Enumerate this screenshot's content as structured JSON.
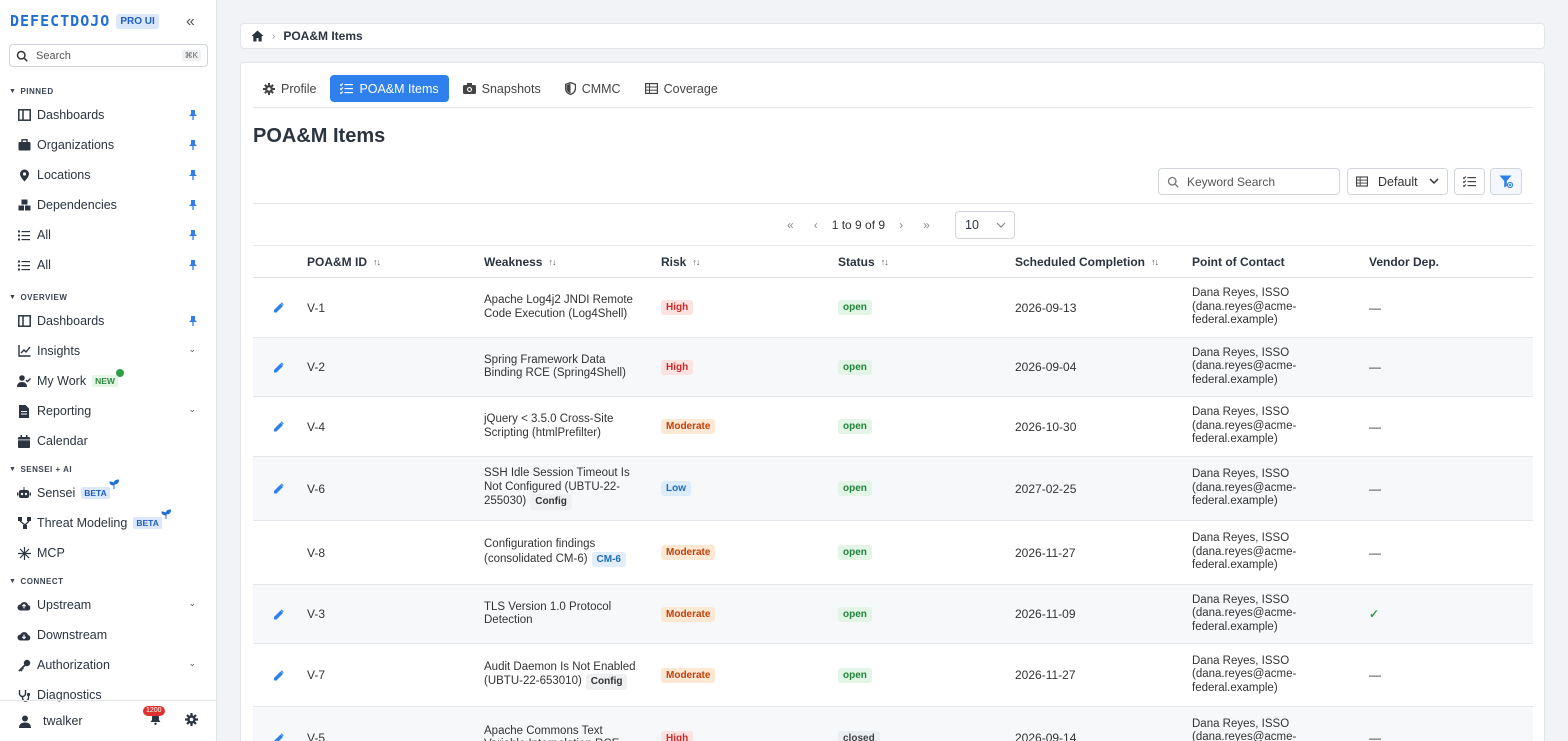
{
  "sidebar": {
    "logo": "DEFECTDOJO",
    "pro_badge": "PRO UI",
    "search_placeholder": "Search",
    "search_shortcut": "⌘K",
    "sections": {
      "pinned": "PINNED",
      "overview": "OVERVIEW",
      "sensei": "SENSEI + AI",
      "connect": "CONNECT"
    },
    "pinned_items": [
      "Dashboards",
      "Organizations",
      "Locations",
      "Dependencies",
      "All",
      "All"
    ],
    "overview_items": [
      "Dashboards",
      "Insights",
      "My Work",
      "Reporting",
      "Calendar"
    ],
    "new_badge": "NEW",
    "sensei_items": [
      "Sensei",
      "Threat Modeling",
      "MCP"
    ],
    "beta_badge": "BETA",
    "connect_items": [
      "Upstream",
      "Downstream",
      "Authorization",
      "Diagnostics"
    ],
    "user": "twalker",
    "notification_count": "1200"
  },
  "breadcrumb": {
    "current": "POA&M Items"
  },
  "tabs": [
    "Profile",
    "POA&M Items",
    "Snapshots",
    "CMMC",
    "Coverage"
  ],
  "active_tab": 1,
  "page_title": "POA&M Items",
  "toolbar": {
    "keyword_placeholder": "Keyword Search",
    "view_value": "Default"
  },
  "pagination": {
    "range": "1 to 9 of 9",
    "per_page": "10"
  },
  "table": {
    "columns": [
      "POA&M ID",
      "Weakness",
      "Risk",
      "Status",
      "Scheduled Completion",
      "Point of Contact",
      "Vendor Dep."
    ],
    "rows": [
      {
        "id": "V-1",
        "weakness": "Apache Log4j2 JNDI Remote Code Execution (Log4Shell)",
        "tag": "",
        "risk": "High",
        "status": "open",
        "date": "2026-09-13",
        "poc": "Dana Reyes, ISSO (dana.reyes@acme-federal.example)",
        "vendor": "—",
        "editable": true
      },
      {
        "id": "V-2",
        "weakness": "Spring Framework Data Binding RCE (Spring4Shell)",
        "tag": "",
        "risk": "High",
        "status": "open",
        "date": "2026-09-04",
        "poc": "Dana Reyes, ISSO (dana.reyes@acme-federal.example)",
        "vendor": "—",
        "editable": true
      },
      {
        "id": "V-4",
        "weakness": "jQuery < 3.5.0 Cross-Site Scripting (htmlPrefilter)",
        "tag": "",
        "risk": "Moderate",
        "status": "open",
        "date": "2026-10-30",
        "poc": "Dana Reyes, ISSO (dana.reyes@acme-federal.example)",
        "vendor": "—",
        "editable": true
      },
      {
        "id": "V-6",
        "weakness": "SSH Idle Session Timeout Is Not Configured (UBTU-22-255030)",
        "tag": "Config",
        "risk": "Low",
        "status": "open",
        "date": "2027-02-25",
        "poc": "Dana Reyes, ISSO (dana.reyes@acme-federal.example)",
        "vendor": "—",
        "editable": true
      },
      {
        "id": "V-8",
        "weakness": "Configuration findings (consolidated CM-6)",
        "tag": "CM-6",
        "risk": "Moderate",
        "status": "open",
        "date": "2026-11-27",
        "poc": "Dana Reyes, ISSO (dana.reyes@acme-federal.example)",
        "vendor": "—",
        "editable": false
      },
      {
        "id": "V-3",
        "weakness": "TLS Version 1.0 Protocol Detection",
        "tag": "",
        "risk": "Moderate",
        "status": "open",
        "date": "2026-11-09",
        "poc": "Dana Reyes, ISSO (dana.reyes@acme-federal.example)",
        "vendor": "✓",
        "editable": true
      },
      {
        "id": "V-7",
        "weakness": "Audit Daemon Is Not Enabled (UBTU-22-653010)",
        "tag": "Config",
        "risk": "Moderate",
        "status": "open",
        "date": "2026-11-27",
        "poc": "Dana Reyes, ISSO (dana.reyes@acme-federal.example)",
        "vendor": "—",
        "editable": true
      },
      {
        "id": "V-5",
        "weakness": "Apache Commons Text Variable Interpolation RCE",
        "tag": "",
        "risk": "High",
        "status": "closed",
        "date": "2026-09-14",
        "poc": "Dana Reyes, ISSO (dana.reyes@acme-federal.example)",
        "vendor": "—",
        "editable": true
      }
    ]
  },
  "colors": {
    "accent": "#2f80ed",
    "brand": "#1f6fd4",
    "high": "#c92a2a",
    "moderate": "#c2410c",
    "low": "#1c6fb8",
    "open": "#23843a",
    "check": "#2e9e4a"
  }
}
